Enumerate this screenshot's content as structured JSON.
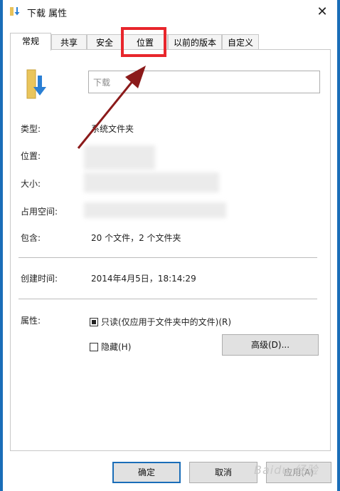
{
  "window": {
    "title": "下载 属性",
    "close_glyph": "✕"
  },
  "tabs": [
    {
      "label": "常规",
      "active": true
    },
    {
      "label": "共享"
    },
    {
      "label": "安全"
    },
    {
      "label": "位置"
    },
    {
      "label": "以前的版本"
    },
    {
      "label": "自定义"
    }
  ],
  "general": {
    "folder_name": "下载",
    "rows": {
      "type": {
        "label": "类型:",
        "value": "系统文件夹"
      },
      "location": {
        "label": "位置:"
      },
      "size": {
        "label": "大小:"
      },
      "size_on_disk": {
        "label": "占用空间:"
      },
      "contains": {
        "label": "包含:",
        "value": "20 个文件，2 个文件夹"
      },
      "created": {
        "label": "创建时间:",
        "value": "2014年4月5日，18:14:29"
      },
      "attributes": {
        "label": "属性:"
      }
    },
    "readonly": {
      "label": "只读(仅应用于文件夹中的文件)(R)",
      "checked": true
    },
    "hidden": {
      "label": "隐藏(H)",
      "checked": false
    },
    "advanced_button": "高级(D)..."
  },
  "buttons": {
    "ok": "确定",
    "cancel": "取消",
    "apply": "应用(A)"
  },
  "annotation_color": "#e8262c",
  "accent_color": "#1a6db8",
  "watermark": "Baidu 经验"
}
